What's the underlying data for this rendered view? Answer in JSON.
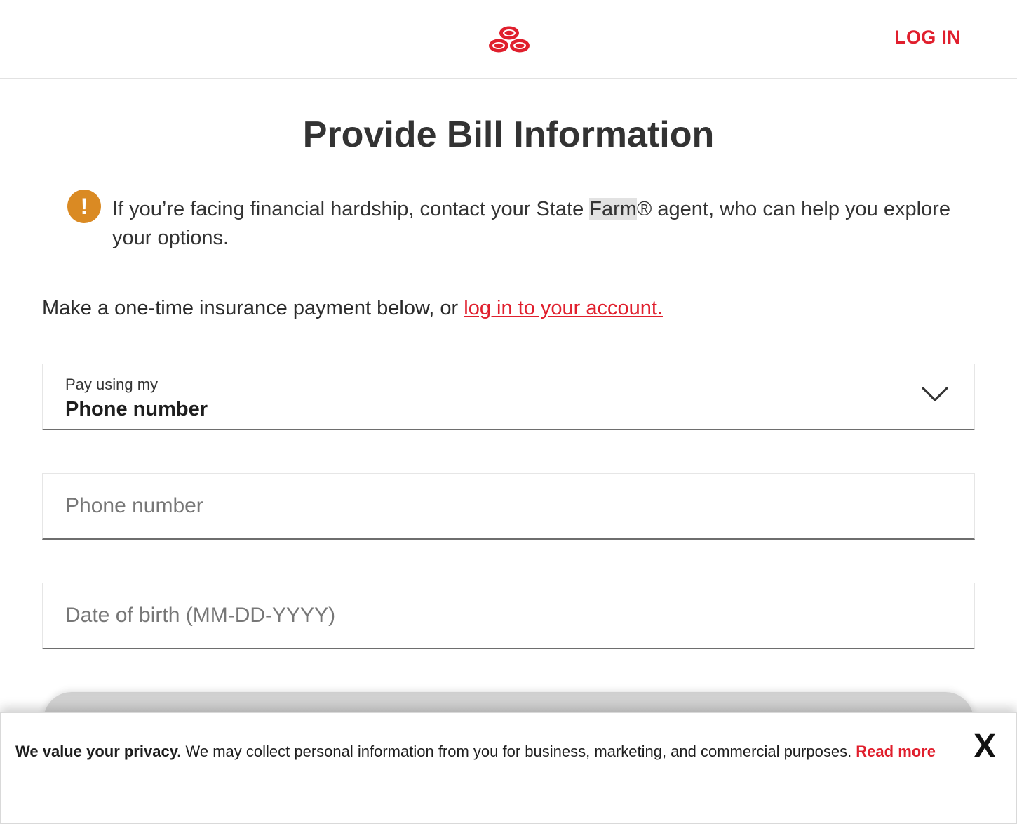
{
  "header": {
    "logo_icon": "state-farm-three-ovals-logo",
    "login_label": "LOG IN"
  },
  "page": {
    "title": "Provide Bill Information"
  },
  "notice": {
    "icon": "exclamation-circle-icon",
    "text_before": "If you’re facing financial hardship, contact your State ",
    "text_highlight": "Farm",
    "text_after": "® agent, who can help you explore your options."
  },
  "intro": {
    "text": "Make a one-time insurance payment below, or ",
    "link_label": "log in to your account."
  },
  "form": {
    "pay_using": {
      "caption": "Pay using my",
      "selected": "Phone number"
    },
    "phone_placeholder": "Phone number",
    "dob_placeholder": "Date of birth (MM-DD-YYYY)"
  },
  "privacy": {
    "bold": "We value your privacy.",
    "text": " We may collect personal information from you for business, marketing, and commercial purposes. ",
    "link_label": "Read more",
    "close_label": "X"
  },
  "colors": {
    "brand_red": "#e01f2d",
    "warning_orange": "#da8a23"
  }
}
